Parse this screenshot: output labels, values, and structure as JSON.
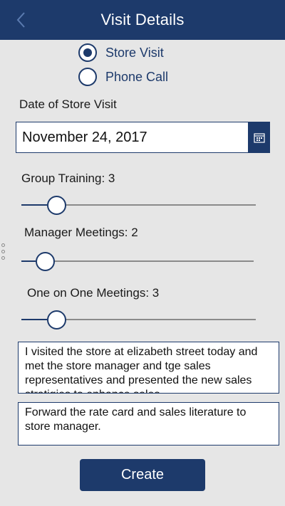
{
  "header": {
    "title": "Visit Details",
    "back_icon": "chevron-left-icon"
  },
  "visit_type": {
    "options": [
      {
        "label": "Store Visit",
        "selected": true
      },
      {
        "label": "Phone Call",
        "selected": false
      }
    ]
  },
  "date": {
    "label": "Date of Store Visit",
    "value": "November 24, 2017",
    "icon": "calendar-icon"
  },
  "sliders": [
    {
      "label": "Group Training: 3",
      "value": 3
    },
    {
      "label": "Manager Meetings: 2",
      "value": 2
    },
    {
      "label": "One on One Meetings: 3",
      "value": 3
    }
  ],
  "notes": {
    "visit_summary": "I visited the        store at elizabeth street today and met the store manager and tge sales representatives and presented the new sales stratigies to enhance sales.",
    "follow_up": "Forward the rate card and sales literature to store manager."
  },
  "actions": {
    "create_label": "Create"
  },
  "colors": {
    "primary": "#1d3a6b",
    "background": "#e6e6e6"
  }
}
